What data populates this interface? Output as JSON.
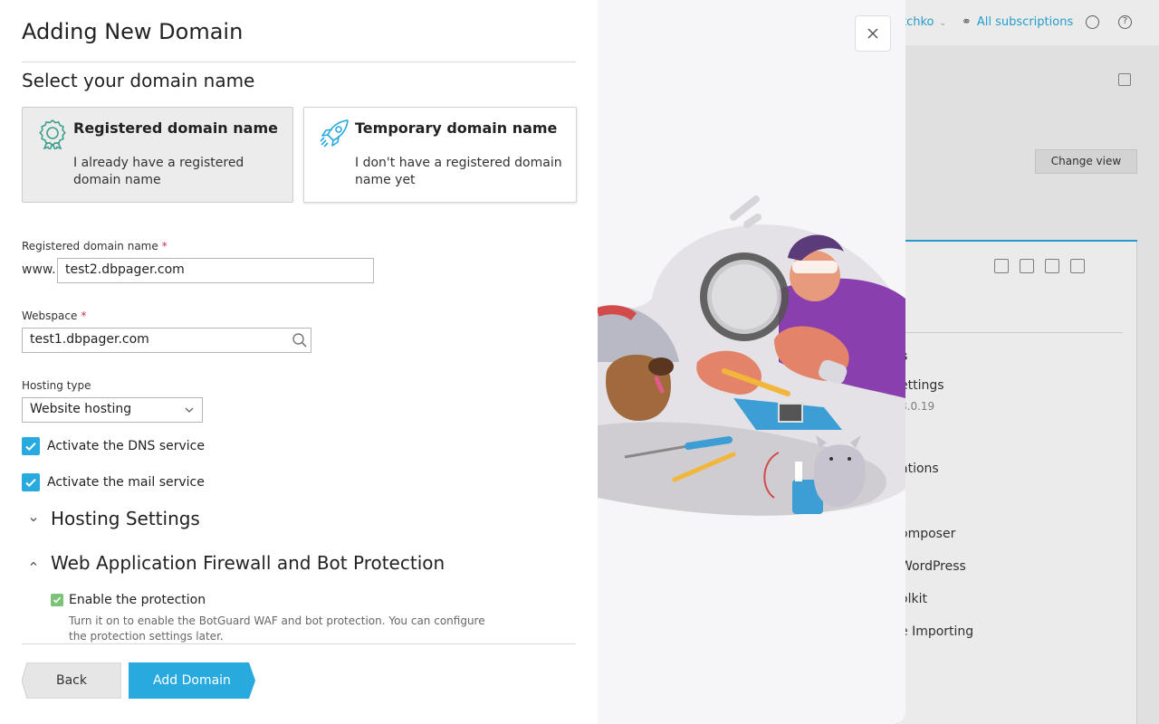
{
  "background_app": {
    "user_menu": "tchko",
    "subscriptions_link": "All subscriptions",
    "change_view_button": "Change view",
    "side_items": [
      {
        "text": "s"
      },
      {
        "text": "ettings"
      },
      {
        "text": "8.0.19"
      },
      {
        "text": "ations"
      },
      {
        "text": "omposer"
      },
      {
        "text": "WordPress"
      },
      {
        "text": "olkit"
      },
      {
        "text": "e Importing"
      }
    ]
  },
  "dialog": {
    "title": "Adding New Domain",
    "close_icon": "close-icon",
    "section_title": "Select your domain name",
    "cards": {
      "registered": {
        "title": "Registered domain name",
        "description": "I already have a registered domain name",
        "icon": "award-badge-icon",
        "selected": true
      },
      "temporary": {
        "title": "Temporary domain name",
        "description": "I don't have a registered domain name yet",
        "icon": "rocket-icon",
        "selected": false
      }
    },
    "domain_field": {
      "label": "Registered domain name",
      "required_mark": "*",
      "prefix": "www.",
      "value": "test2.dbpager.com"
    },
    "webspace_field": {
      "label": "Webspace",
      "required_mark": "*",
      "value": "test1.dbpager.com"
    },
    "hosting_type": {
      "label": "Hosting type",
      "value": "Website hosting"
    },
    "dns_checkbox": {
      "label": "Activate the DNS service",
      "checked": true
    },
    "mail_checkbox": {
      "label": "Activate the mail service",
      "checked": true
    },
    "hosting_settings": {
      "title": "Hosting Settings",
      "expanded": false
    },
    "waf_section": {
      "title": "Web Application Firewall and Bot Protection",
      "expanded": true,
      "protection_checkbox": {
        "label": "Enable the protection",
        "checked": true,
        "help": "Turn it on to enable the BotGuard WAF and bot protection. You can configure the protection settings later."
      }
    },
    "buttons": {
      "back": "Back",
      "submit": "Add Domain"
    }
  },
  "colors": {
    "accent": "#28aade",
    "required": "#d02d4b",
    "card_icon": "#3d9f8a",
    "protection_check": "#7dc27a"
  }
}
